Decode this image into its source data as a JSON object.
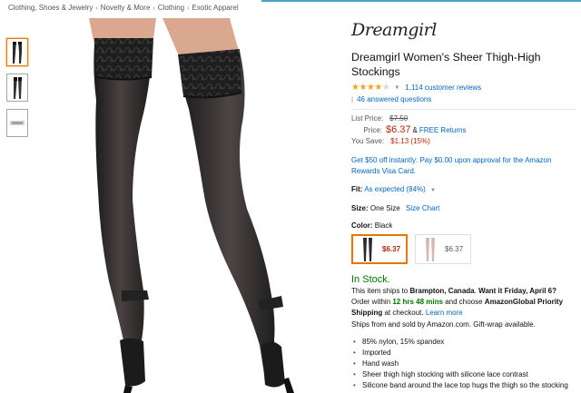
{
  "breadcrumb": [
    "Clothing, Shoes & Jewelry",
    "Novelty & More",
    "Clothing",
    "Exotic Apparel"
  ],
  "breadcrumb_separator": "›",
  "brand": {
    "logo_text": "Dreamgirl"
  },
  "product": {
    "title": "Dreamgirl Women's Sheer Thigh-High Stockings",
    "rating": 4.5,
    "rating_stars": "★★★★",
    "rating_half": "★",
    "reviews": "1,114 customer reviews",
    "answered": "46 answered questions"
  },
  "pricing": {
    "list_label": "List Price:",
    "list_price": "$7.50",
    "price_label": "Price:",
    "price": "$6.37",
    "amp": "&",
    "free_returns": "FREE Returns",
    "save_label": "You Save:",
    "save_value": "$1.13 (15%)"
  },
  "promo": "Get $50 off instantly: Pay $0.00 upon approval for the Amazon Rewards Visa Card.",
  "fit": {
    "label": "Fit:",
    "value": "As expected (84%)"
  },
  "size": {
    "label": "Size:",
    "value": "One Size",
    "chart": "Size Chart"
  },
  "color": {
    "label": "Color:",
    "value": "Black",
    "swatches": [
      {
        "price": "$6.37",
        "selected": true,
        "color": "#2a2a2a"
      },
      {
        "price": "$6.37",
        "selected": false,
        "color": "#d9b5b5"
      }
    ]
  },
  "stock": {
    "status": "In Stock.",
    "ship_to_prefix": "This item ships to",
    "ship_to": "Brampton, Canada",
    "want_it": "Want it Friday, April 6?",
    "order_within_prefix": "Order within",
    "countdown": "12 hrs 48 mins",
    "choose": "and choose",
    "global_priority": "AmazonGlobal Priority Shipping",
    "at_checkout": "at checkout.",
    "learn_more": "Learn more",
    "sold_by": "Ships from and sold by Amazon.com. Gift-wrap available."
  },
  "features": [
    "85% nylon, 15% spandex",
    "Imported",
    "Hand wash",
    "Sheer thigh high stocking with silicone lace contrast",
    "Silicone band around the lace top hugs the thigh so the stocking stays up"
  ],
  "colors": {
    "link": "#0066c0",
    "price": "#b12704",
    "in_stock": "#007600",
    "star": "#f4a41d",
    "accent": "#e77600"
  }
}
